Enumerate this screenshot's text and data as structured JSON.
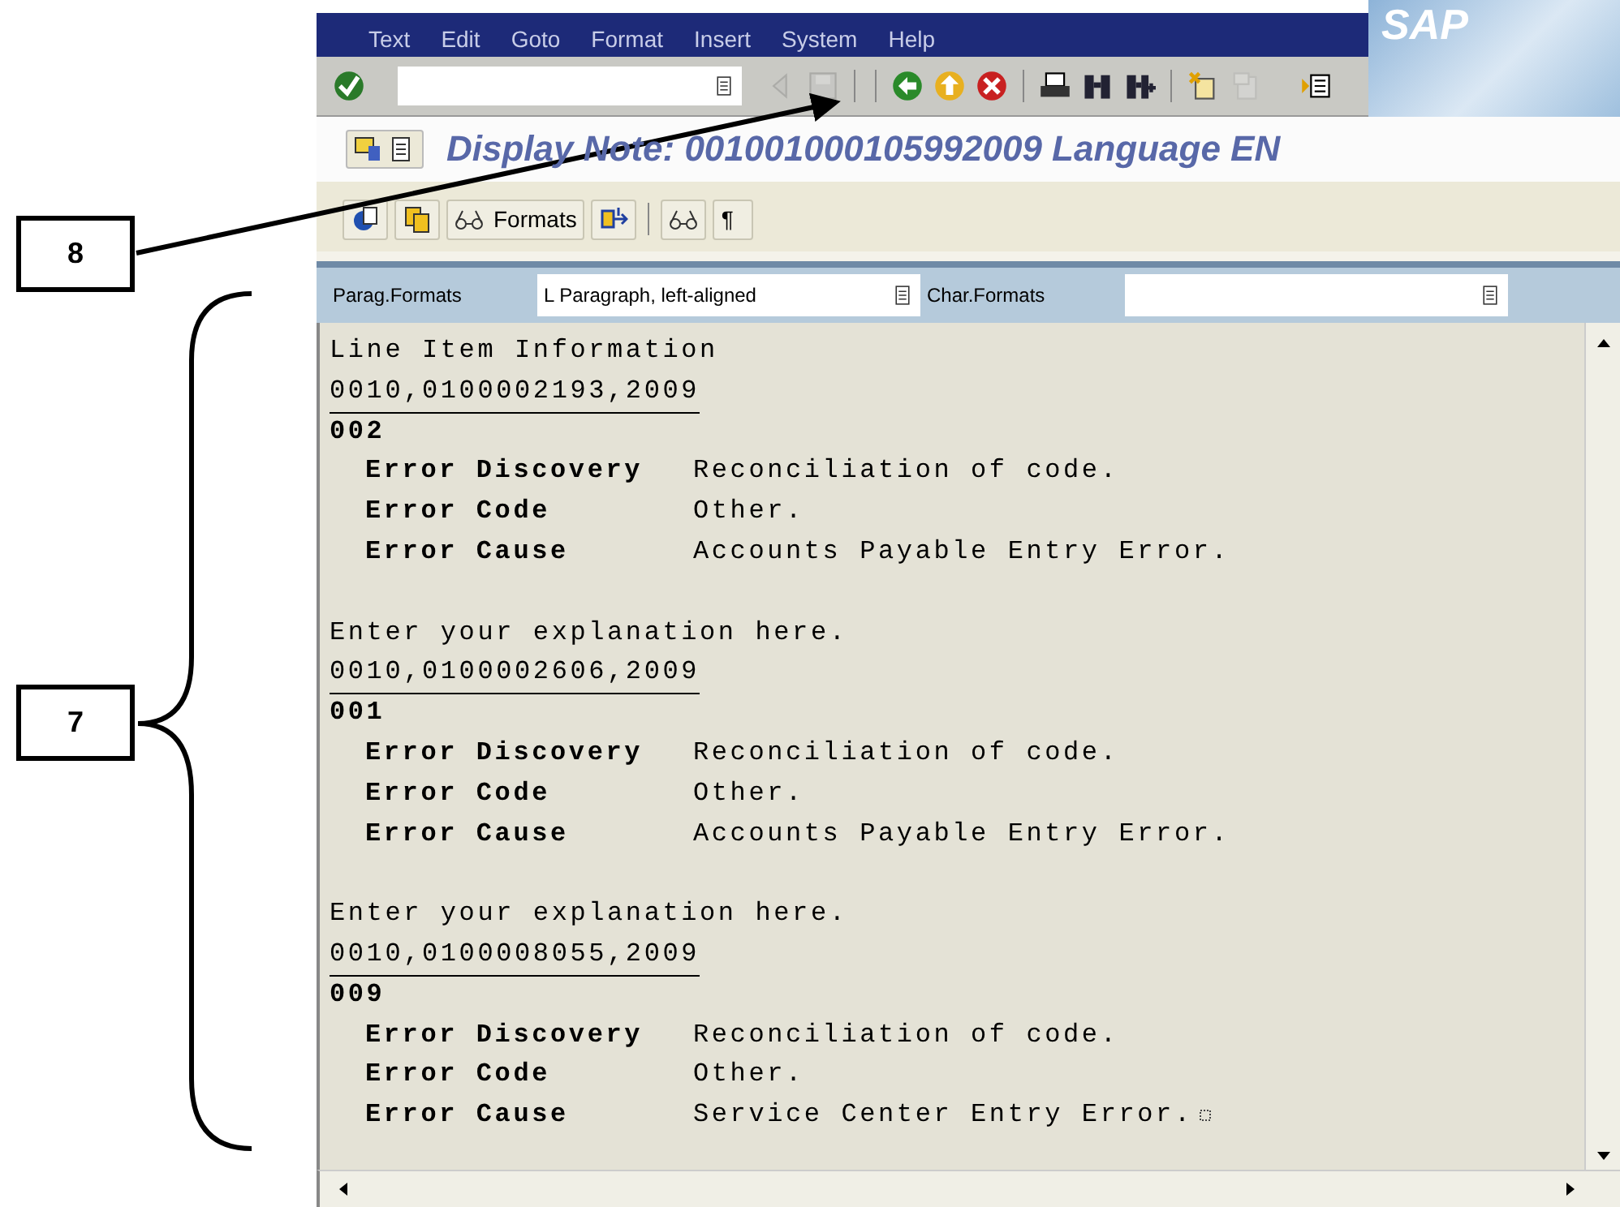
{
  "annotations": [
    {
      "label": "8"
    },
    {
      "label": "7"
    }
  ],
  "menu": [
    {
      "label": "Text"
    },
    {
      "label": "Edit"
    },
    {
      "label": "Goto"
    },
    {
      "label": "Format"
    },
    {
      "label": "Insert"
    },
    {
      "label": "System"
    },
    {
      "label": "Help"
    }
  ],
  "logo": "SAP",
  "toolbar_groups": [
    [
      {
        "kind": "prev",
        "disabled": true
      },
      {
        "kind": "save",
        "disabled": true
      }
    ],
    [
      {
        "kind": "back",
        "disabled": false
      },
      {
        "kind": "exit",
        "disabled": false
      },
      {
        "kind": "cancel",
        "disabled": false
      }
    ],
    [
      {
        "kind": "print",
        "disabled": false
      },
      {
        "kind": "find",
        "disabled": false
      },
      {
        "kind": "findnext",
        "disabled": false
      }
    ],
    [
      {
        "kind": "session",
        "disabled": false
      },
      {
        "kind": "shortcut",
        "disabled": true
      }
    ],
    [
      {
        "kind": "help",
        "disabled": false
      }
    ]
  ],
  "title": "Display Note: 001001000105992009 Language EN",
  "app_toolbar": {
    "formats_button": "Formats",
    "paragraph_mark": "¶"
  },
  "format_bar": {
    "paragraph_label": "Parag.Formats",
    "paragraph_value": "L Paragraph, left-aligned",
    "char_label": "Char.Formats"
  },
  "editor_lines": [
    {
      "kind": "text",
      "text": "Line Item Information"
    },
    {
      "kind": "reference",
      "text": "0010,0100002193,2009"
    },
    {
      "kind": "code",
      "text": "002"
    },
    {
      "kind": "field",
      "label": "Error Discovery",
      "value": "Reconciliation of code."
    },
    {
      "kind": "field",
      "label": "Error Code",
      "value": "Other."
    },
    {
      "kind": "field",
      "label": "Error Cause",
      "value": "Accounts Payable Entry Error."
    },
    {
      "kind": "blank"
    },
    {
      "kind": "text",
      "text": "Enter your explanation here."
    },
    {
      "kind": "reference",
      "text": "0010,0100002606,2009"
    },
    {
      "kind": "code",
      "text": "001"
    },
    {
      "kind": "field",
      "label": "Error Discovery",
      "value": "Reconciliation of code."
    },
    {
      "kind": "field",
      "label": "Error Code",
      "value": "Other."
    },
    {
      "kind": "field",
      "label": "Error Cause",
      "value": "Accounts Payable Entry Error."
    },
    {
      "kind": "blank"
    },
    {
      "kind": "text",
      "text": "Enter your explanation here."
    },
    {
      "kind": "reference",
      "text": "0010,0100008055,2009"
    },
    {
      "kind": "code",
      "text": "009"
    },
    {
      "kind": "field",
      "label": "Error Discovery",
      "value": "Reconciliation of code."
    },
    {
      "kind": "field",
      "label": "Error Code",
      "value": "Other."
    },
    {
      "kind": "field",
      "label": "Error Cause",
      "value": "Service Center Entry Error.",
      "end_mark": true
    }
  ]
}
